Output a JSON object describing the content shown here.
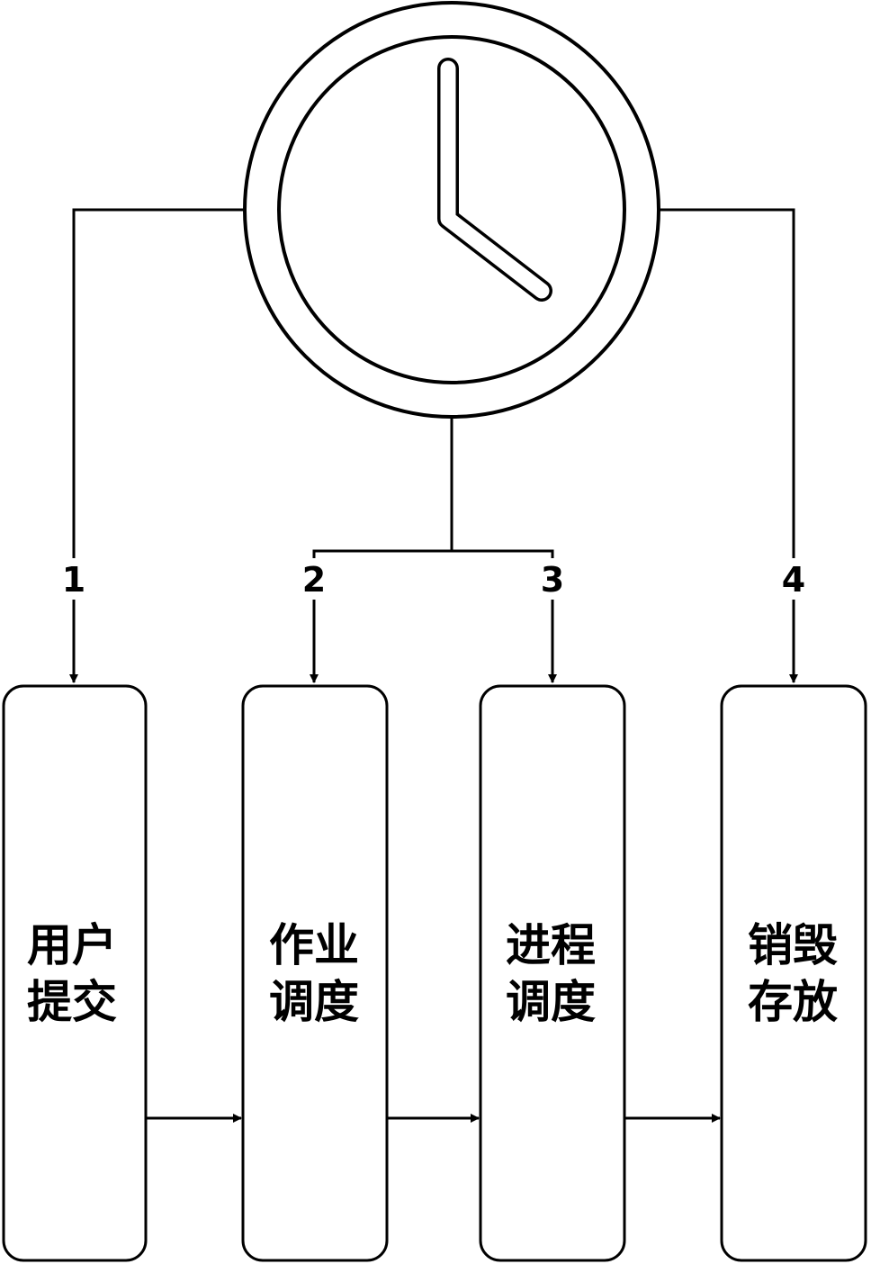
{
  "stages": [
    {
      "number": "1",
      "line1": "用户",
      "line2": "提交"
    },
    {
      "number": "2",
      "line1": "作业",
      "line2": "调度"
    },
    {
      "number": "3",
      "line1": "进程",
      "line2": "调度"
    },
    {
      "number": "4",
      "line1": "销毁",
      "line2": "存放"
    }
  ],
  "icons": {
    "timer": "clock-icon"
  },
  "colors": {
    "stroke": "#000000",
    "fill": "#ffffff"
  }
}
